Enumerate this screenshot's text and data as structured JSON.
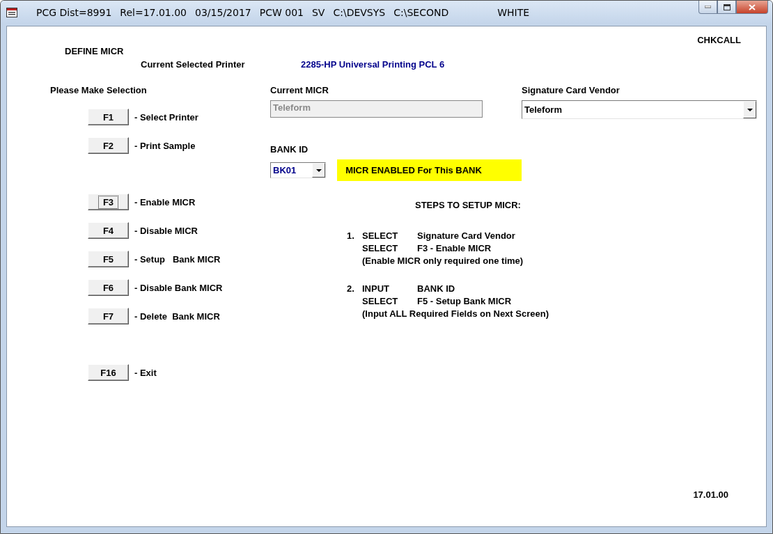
{
  "window": {
    "title_parts": [
      "PCG Dist=8991",
      "Rel=17.01.00",
      "03/15/2017",
      "PCW 001",
      "SV",
      "C:\\DEVSYS",
      "C:\\SECOND",
      "WHITE"
    ]
  },
  "screen_code": "CHKCALL",
  "heading": "DEFINE MICR",
  "printer": {
    "label": "Current Selected Printer",
    "value": "2285-HP Universal Printing PCL 6"
  },
  "selection_heading": "Please Make Selection",
  "function_key_groups": [
    [
      {
        "key": "F1",
        "label": "- Select Printer",
        "focused": false
      },
      {
        "key": "F2",
        "label": "- Print Sample",
        "focused": false
      }
    ],
    [
      {
        "key": "F3",
        "label": "- Enable MICR",
        "focused": true
      },
      {
        "key": "F4",
        "label": "- Disable MICR",
        "focused": false
      },
      {
        "key": "F5",
        "label": "- Setup   Bank MICR",
        "focused": false
      },
      {
        "key": "F6",
        "label": "- Disable Bank MICR",
        "focused": false
      },
      {
        "key": "F7",
        "label": "- Delete  Bank MICR",
        "focused": false
      }
    ],
    [
      {
        "key": "F16",
        "label": "- Exit",
        "focused": false
      }
    ]
  ],
  "current_micr": {
    "label": "Current MICR",
    "value": "Teleform",
    "disabled": true
  },
  "vendor": {
    "label": "Signature Card Vendor",
    "value": "Teleform"
  },
  "bank_id": {
    "label": "BANK ID",
    "value": "BK01"
  },
  "status_banner": "MICR ENABLED For This BANK",
  "steps": {
    "heading": "STEPS TO SETUP MICR:",
    "items": [
      {
        "number": "1.",
        "lines": [
          {
            "kind": "action",
            "verb": "SELECT",
            "text": "Signature Card Vendor"
          },
          {
            "kind": "action",
            "verb": "SELECT",
            "text": "F3 - Enable MICR"
          },
          {
            "kind": "note",
            "text": "(Enable MICR only required one time)"
          }
        ]
      },
      {
        "number": "2.",
        "lines": [
          {
            "kind": "action",
            "verb": "INPUT",
            "text": "BANK ID"
          },
          {
            "kind": "action",
            "verb": "SELECT",
            "text": "F5 - Setup Bank MICR"
          },
          {
            "kind": "note",
            "text": "(Input ALL Required Fields on Next Screen)"
          }
        ]
      }
    ]
  },
  "version": "17.01.00"
}
